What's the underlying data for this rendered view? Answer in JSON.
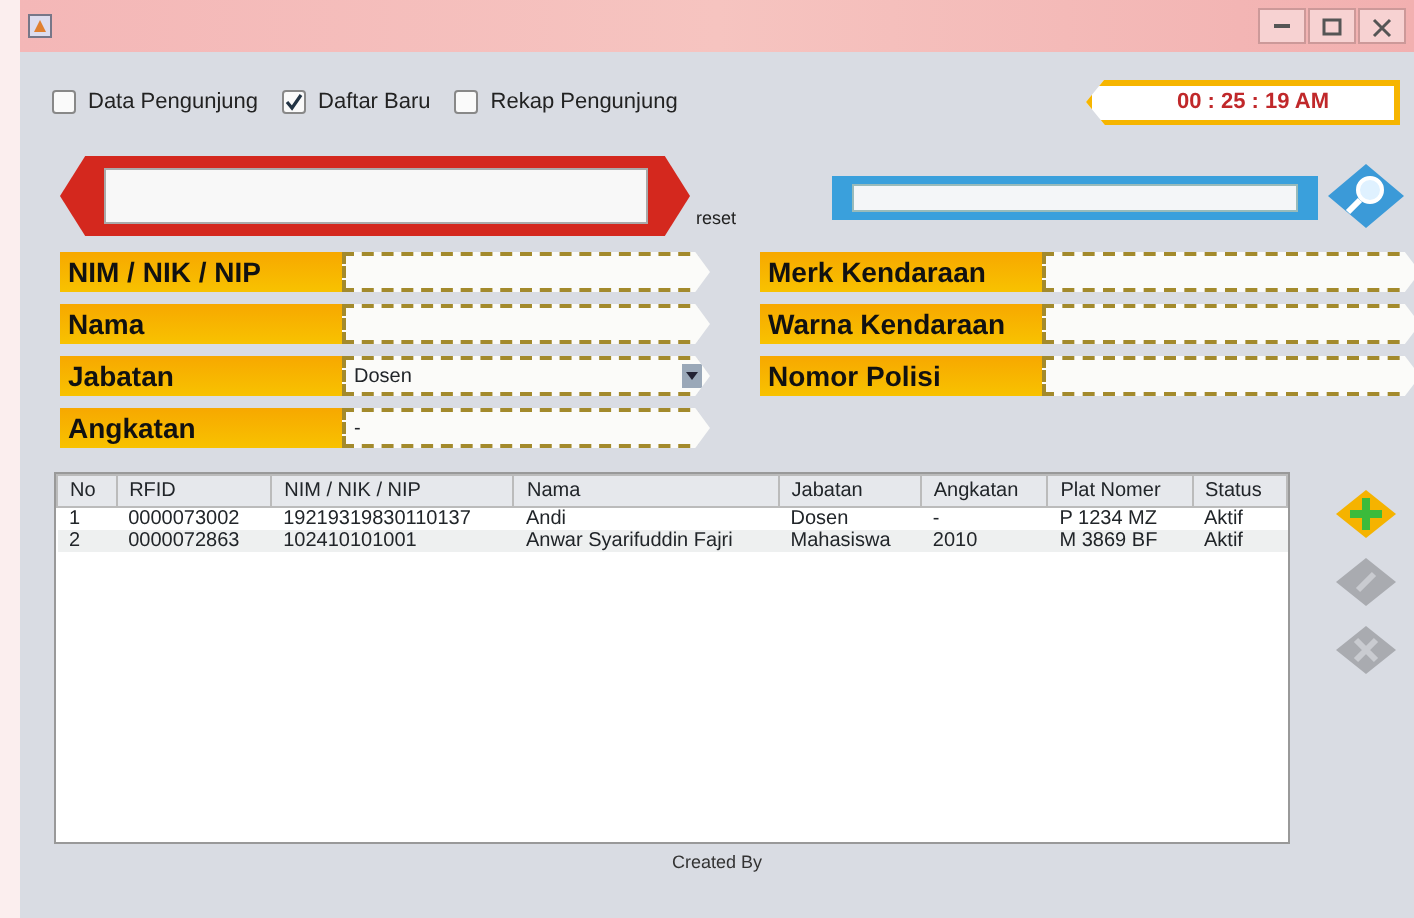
{
  "checkboxes": [
    {
      "label": "Data Pengunjung",
      "checked": false
    },
    {
      "label": "Daftar Baru",
      "checked": true
    },
    {
      "label": "Rekap Pengunjung",
      "checked": false
    }
  ],
  "clock": "00 : 25 : 19 AM",
  "reset": "reset",
  "left_fields": [
    {
      "label": "NIM / NIK / NIP",
      "kind": "text"
    },
    {
      "label": "Nama",
      "kind": "text"
    },
    {
      "label": "Jabatan",
      "kind": "select",
      "value": "Dosen"
    },
    {
      "label": "Angkatan",
      "kind": "text",
      "value": "-"
    }
  ],
  "right_fields": [
    {
      "label": "Merk Kendaraan",
      "kind": "text"
    },
    {
      "label": "Warna Kendaraan",
      "kind": "text"
    },
    {
      "label": "Nomor Polisi",
      "kind": "text"
    }
  ],
  "table": {
    "columns": [
      "No",
      "RFID",
      "NIM / NIK / NIP",
      "Nama",
      "Jabatan",
      "Angkatan",
      "Plat Nomer",
      "Status"
    ],
    "rows": [
      [
        "1",
        "0000073002",
        "19219319830110137",
        "Andi",
        "Dosen",
        "-",
        "P 1234 MZ",
        "Aktif"
      ],
      [
        "2",
        "0000072863",
        "102410101001",
        "Anwar Syarifuddin Fajri",
        "Mahasiswa",
        "2010",
        "M 3869 BF",
        "Aktif"
      ]
    ]
  },
  "side_buttons": [
    {
      "kind": "add",
      "disabled": false
    },
    {
      "kind": "edit",
      "disabled": true
    },
    {
      "kind": "delete",
      "disabled": true
    }
  ],
  "footer": "Created By"
}
